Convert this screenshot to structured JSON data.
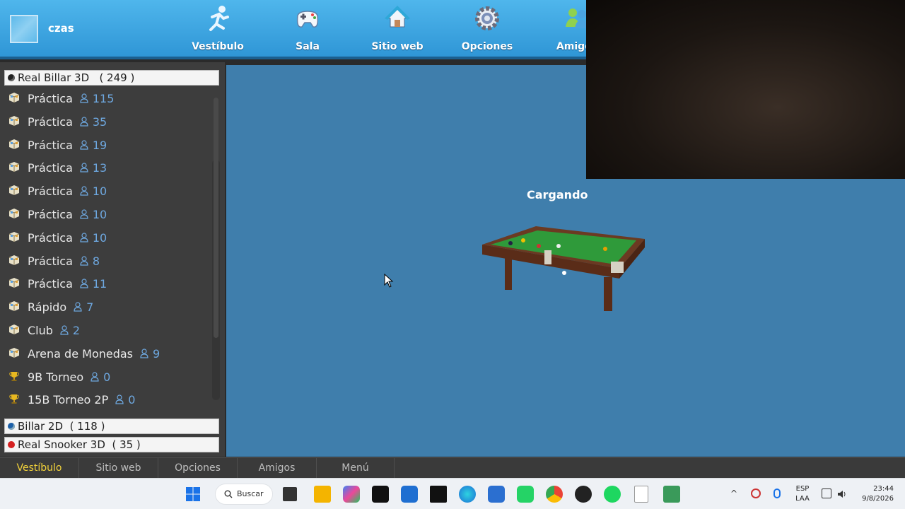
{
  "user": {
    "name": "czas"
  },
  "nav": [
    {
      "label": "Vestíbulo",
      "icon": "runner-icon"
    },
    {
      "label": "Sala",
      "icon": "gamepad-icon"
    },
    {
      "label": "Sitio web",
      "icon": "house-icon"
    },
    {
      "label": "Opciones",
      "icon": "gear-icon"
    },
    {
      "label": "Amigos",
      "icon": "friends-icon"
    }
  ],
  "groups": [
    {
      "name": "Real Billar 3D",
      "count": "( 249 )",
      "dot_color": "#222222"
    },
    {
      "name": "Billar 2D",
      "count": "( 118 )",
      "dot_color": "#1b5fa8"
    },
    {
      "name": "Real Snooker 3D",
      "count": "( 35 )",
      "dot_color": "#d42020"
    }
  ],
  "rooms": [
    {
      "name": "Práctica",
      "count": "115",
      "icon": "box-icon"
    },
    {
      "name": "Práctica",
      "count": "35",
      "icon": "box-icon"
    },
    {
      "name": "Práctica",
      "count": "19",
      "icon": "box-icon"
    },
    {
      "name": "Práctica",
      "count": "13",
      "icon": "box-icon"
    },
    {
      "name": "Práctica",
      "count": "10",
      "icon": "box-icon"
    },
    {
      "name": "Práctica",
      "count": "10",
      "icon": "box-icon"
    },
    {
      "name": "Práctica",
      "count": "10",
      "icon": "box-icon"
    },
    {
      "name": "Práctica",
      "count": "8",
      "icon": "box-icon"
    },
    {
      "name": "Práctica",
      "count": "11",
      "icon": "box-icon"
    },
    {
      "name": "Rápido",
      "count": "7",
      "icon": "box-icon"
    },
    {
      "name": "Club",
      "count": "2",
      "icon": "box-icon"
    },
    {
      "name": "Arena de Monedas",
      "count": "9",
      "icon": "box-icon"
    },
    {
      "name": "9B Torneo",
      "count": "0",
      "icon": "trophy-icon"
    },
    {
      "name": "15B Torneo 2P",
      "count": "0",
      "icon": "trophy-icon"
    }
  ],
  "main": {
    "status": "Cargando"
  },
  "bottom_tabs": [
    {
      "label": "Vestíbulo",
      "active": true
    },
    {
      "label": "Sitio web",
      "active": false
    },
    {
      "label": "Opciones",
      "active": false
    },
    {
      "label": "Amigos",
      "active": false
    },
    {
      "label": "Menú",
      "active": false
    }
  ],
  "taskbar": {
    "search_label": "Buscar",
    "lang_1": "ESP",
    "lang_2": "LAA",
    "time": "23:44",
    "date": "9/8/2026"
  },
  "colors": {
    "topbar": "#3aa4e0",
    "main_bg": "#3f7eac",
    "active_tab": "#f2d23a",
    "count_blue": "#6ea8e0"
  }
}
